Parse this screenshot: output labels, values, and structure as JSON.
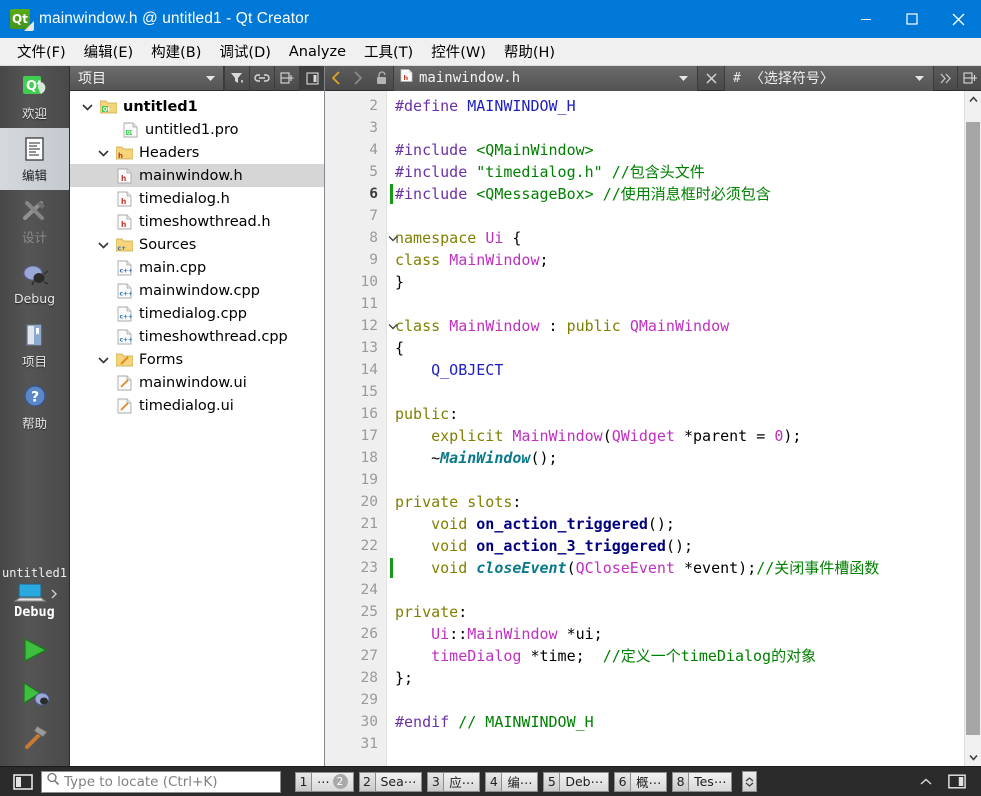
{
  "window": {
    "title": "mainwindow.h @ untitled1 - Qt Creator",
    "app_icon": "qt-logo-icon",
    "minimize": "minimize-icon",
    "maximize": "maximize-icon",
    "close": "close-icon",
    "titlebar_color": "#0078d7"
  },
  "menubar": {
    "items": [
      {
        "label": "文件(F)",
        "mnemonic": "F"
      },
      {
        "label": "编辑(E)",
        "mnemonic": "E"
      },
      {
        "label": "构建(B)",
        "mnemonic": "B"
      },
      {
        "label": "调试(D)",
        "mnemonic": "D"
      },
      {
        "label": "Analyze",
        "mnemonic": "A"
      },
      {
        "label": "工具(T)",
        "mnemonic": "T"
      },
      {
        "label": "控件(W)",
        "mnemonic": "W"
      },
      {
        "label": "帮助(H)",
        "mnemonic": "H"
      }
    ]
  },
  "modebar": {
    "modes": [
      {
        "label": "欢迎",
        "icon": "qt-welcome-icon",
        "state": "normal"
      },
      {
        "label": "编辑",
        "icon": "edit-document-icon",
        "state": "active"
      },
      {
        "label": "设计",
        "icon": "design-tools-icon",
        "state": "disabled"
      },
      {
        "label": "Debug",
        "icon": "debug-bug-icon",
        "state": "normal"
      },
      {
        "label": "项目",
        "icon": "projects-book-icon",
        "state": "normal"
      },
      {
        "label": "帮助",
        "icon": "help-question-icon",
        "state": "normal"
      }
    ],
    "kit": {
      "project_name": "untitled1",
      "build_config": "Debug",
      "target_icon": "desktop-target-icon",
      "run_button": "run-play-icon",
      "debug_button": "start-debugging-icon",
      "build_button": "build-hammer-icon"
    }
  },
  "project_panel": {
    "selector_label": "项目",
    "toolbar": [
      {
        "icon": "filter-icon",
        "name": "filter-tree-button"
      },
      {
        "icon": "link-icon",
        "name": "synchronize-with-editor-button"
      },
      {
        "icon": "collapse-all-icon",
        "name": "collapse-all-button"
      },
      {
        "icon": "split-icon",
        "name": "panel-layout-button"
      }
    ],
    "tree": [
      {
        "label": "untitled1",
        "icon": "qt-project-icon",
        "depth": 0,
        "expandable": true,
        "expanded": true,
        "bold": true,
        "selected": false
      },
      {
        "label": "untitled1.pro",
        "icon": "pro-file-icon",
        "depth": 1,
        "expandable": false,
        "expanded": false,
        "bold": false,
        "selected": false
      },
      {
        "label": "Headers",
        "icon": "folder-h-icon",
        "depth": 1,
        "expandable": true,
        "expanded": true,
        "bold": false,
        "selected": false
      },
      {
        "label": "mainwindow.h",
        "icon": "header-file-icon",
        "depth": 2,
        "expandable": false,
        "expanded": false,
        "bold": false,
        "selected": true
      },
      {
        "label": "timedialog.h",
        "icon": "header-file-icon",
        "depth": 2,
        "expandable": false,
        "expanded": false,
        "bold": false,
        "selected": false
      },
      {
        "label": "timeshowthread.h",
        "icon": "header-file-icon",
        "depth": 2,
        "expandable": false,
        "expanded": false,
        "bold": false,
        "selected": false
      },
      {
        "label": "Sources",
        "icon": "folder-cpp-icon",
        "depth": 1,
        "expandable": true,
        "expanded": true,
        "bold": false,
        "selected": false
      },
      {
        "label": "main.cpp",
        "icon": "cpp-file-icon",
        "depth": 2,
        "expandable": false,
        "expanded": false,
        "bold": false,
        "selected": false
      },
      {
        "label": "mainwindow.cpp",
        "icon": "cpp-file-icon",
        "depth": 2,
        "expandable": false,
        "expanded": false,
        "bold": false,
        "selected": false
      },
      {
        "label": "timedialog.cpp",
        "icon": "cpp-file-icon",
        "depth": 2,
        "expandable": false,
        "expanded": false,
        "bold": false,
        "selected": false
      },
      {
        "label": "timeshowthread.cpp",
        "icon": "cpp-file-icon",
        "depth": 2,
        "expandable": false,
        "expanded": false,
        "bold": false,
        "selected": false
      },
      {
        "label": "Forms",
        "icon": "folder-ui-icon",
        "depth": 1,
        "expandable": true,
        "expanded": true,
        "bold": false,
        "selected": false
      },
      {
        "label": "mainwindow.ui",
        "icon": "ui-file-icon",
        "depth": 2,
        "expandable": false,
        "expanded": false,
        "bold": false,
        "selected": false
      },
      {
        "label": "timedialog.ui",
        "icon": "ui-file-icon",
        "depth": 2,
        "expandable": false,
        "expanded": false,
        "bold": false,
        "selected": false
      }
    ]
  },
  "editor_toolbar": {
    "back": "back-arrow-icon",
    "forward": "forward-arrow-icon",
    "lock": "unlocked-padlock-icon",
    "file_icon": "header-file-icon",
    "file_name": "mainwindow.h",
    "close_tab": "close-x-icon",
    "symbol_prefix": "#",
    "symbol_label": "〈选择符号〉",
    "overflow": "chevrons-right-icon",
    "split": "split-editor-icon"
  },
  "editor": {
    "first_line": 2,
    "current_line": 6,
    "change_marker_lines": [
      6,
      23
    ],
    "fold_marker_lines": [
      8,
      12
    ],
    "lines": [
      {
        "n": 2,
        "tokens": [
          {
            "t": "#define ",
            "c": "pre"
          },
          {
            "t": "MAINWINDOW_H",
            "c": "macro"
          }
        ]
      },
      {
        "n": 3,
        "tokens": []
      },
      {
        "n": 4,
        "tokens": [
          {
            "t": "#include ",
            "c": "pre"
          },
          {
            "t": "<QMainWindow>",
            "c": "str"
          }
        ]
      },
      {
        "n": 5,
        "tokens": [
          {
            "t": "#include ",
            "c": "pre"
          },
          {
            "t": "\"timedialog.h\"",
            "c": "str"
          },
          {
            "t": " ",
            "c": "plain"
          },
          {
            "t": "//包含头文件",
            "c": "cmt"
          }
        ]
      },
      {
        "n": 6,
        "tokens": [
          {
            "t": "#include ",
            "c": "pre"
          },
          {
            "t": "<QMessageBox>",
            "c": "str"
          },
          {
            "t": " ",
            "c": "plain"
          },
          {
            "t": "//使用消息框时必须包含",
            "c": "cmt"
          }
        ]
      },
      {
        "n": 7,
        "tokens": []
      },
      {
        "n": 8,
        "tokens": [
          {
            "t": "namespace",
            "c": "kw"
          },
          {
            "t": " ",
            "c": "plain"
          },
          {
            "t": "Ui",
            "c": "type"
          },
          {
            "t": " {",
            "c": "plain"
          }
        ]
      },
      {
        "n": 9,
        "tokens": [
          {
            "t": "class",
            "c": "kw"
          },
          {
            "t": " ",
            "c": "plain"
          },
          {
            "t": "MainWindow",
            "c": "type"
          },
          {
            "t": ";",
            "c": "plain"
          }
        ]
      },
      {
        "n": 10,
        "tokens": [
          {
            "t": "}",
            "c": "plain"
          }
        ]
      },
      {
        "n": 11,
        "tokens": []
      },
      {
        "n": 12,
        "tokens": [
          {
            "t": "class",
            "c": "kw"
          },
          {
            "t": " ",
            "c": "plain"
          },
          {
            "t": "MainWindow",
            "c": "type"
          },
          {
            "t": " : ",
            "c": "plain"
          },
          {
            "t": "public",
            "c": "kw"
          },
          {
            "t": " ",
            "c": "plain"
          },
          {
            "t": "QMainWindow",
            "c": "type"
          }
        ]
      },
      {
        "n": 13,
        "tokens": [
          {
            "t": "{",
            "c": "plain"
          }
        ]
      },
      {
        "n": 14,
        "tokens": [
          {
            "t": "    ",
            "c": "plain"
          },
          {
            "t": "Q_OBJECT",
            "c": "macro"
          }
        ]
      },
      {
        "n": 15,
        "tokens": []
      },
      {
        "n": 16,
        "tokens": [
          {
            "t": "public",
            "c": "kw"
          },
          {
            "t": ":",
            "c": "plain"
          }
        ]
      },
      {
        "n": 17,
        "tokens": [
          {
            "t": "    ",
            "c": "plain"
          },
          {
            "t": "explicit",
            "c": "kw"
          },
          {
            "t": " ",
            "c": "plain"
          },
          {
            "t": "MainWindow",
            "c": "type"
          },
          {
            "t": "(",
            "c": "plain"
          },
          {
            "t": "QWidget",
            "c": "type"
          },
          {
            "t": " *parent = ",
            "c": "plain"
          },
          {
            "t": "0",
            "c": "type"
          },
          {
            "t": ");",
            "c": "plain"
          }
        ]
      },
      {
        "n": 18,
        "tokens": [
          {
            "t": "    ",
            "c": "plain"
          },
          {
            "t": "~",
            "c": "plain"
          },
          {
            "t": "MainWindow",
            "c": "virt"
          },
          {
            "t": "();",
            "c": "plain"
          }
        ]
      },
      {
        "n": 19,
        "tokens": []
      },
      {
        "n": 20,
        "tokens": [
          {
            "t": "private",
            "c": "kw"
          },
          {
            "t": " ",
            "c": "plain"
          },
          {
            "t": "slots",
            "c": "kw"
          },
          {
            "t": ":",
            "c": "plain"
          }
        ]
      },
      {
        "n": 21,
        "tokens": [
          {
            "t": "    ",
            "c": "plain"
          },
          {
            "t": "void",
            "c": "kw"
          },
          {
            "t": " ",
            "c": "plain"
          },
          {
            "t": "on_action_triggered",
            "c": "fn"
          },
          {
            "t": "();",
            "c": "plain"
          }
        ]
      },
      {
        "n": 22,
        "tokens": [
          {
            "t": "    ",
            "c": "plain"
          },
          {
            "t": "void",
            "c": "kw"
          },
          {
            "t": " ",
            "c": "plain"
          },
          {
            "t": "on_action_3_triggered",
            "c": "fn"
          },
          {
            "t": "();",
            "c": "plain"
          }
        ]
      },
      {
        "n": 23,
        "tokens": [
          {
            "t": "    ",
            "c": "plain"
          },
          {
            "t": "void",
            "c": "kw"
          },
          {
            "t": " ",
            "c": "plain"
          },
          {
            "t": "closeEvent",
            "c": "virt"
          },
          {
            "t": "(",
            "c": "plain"
          },
          {
            "t": "QCloseEvent",
            "c": "type"
          },
          {
            "t": " *event);",
            "c": "plain"
          },
          {
            "t": "//关闭事件槽函数",
            "c": "cmt"
          }
        ]
      },
      {
        "n": 24,
        "tokens": []
      },
      {
        "n": 25,
        "tokens": [
          {
            "t": "private",
            "c": "kw"
          },
          {
            "t": ":",
            "c": "plain"
          }
        ]
      },
      {
        "n": 26,
        "tokens": [
          {
            "t": "    ",
            "c": "plain"
          },
          {
            "t": "Ui",
            "c": "type"
          },
          {
            "t": "::",
            "c": "plain"
          },
          {
            "t": "MainWindow",
            "c": "type"
          },
          {
            "t": " *ui;",
            "c": "plain"
          }
        ]
      },
      {
        "n": 27,
        "tokens": [
          {
            "t": "    ",
            "c": "plain"
          },
          {
            "t": "timeDialog",
            "c": "type"
          },
          {
            "t": " *time;  ",
            "c": "plain"
          },
          {
            "t": "//定义一个timeDialog的对象",
            "c": "cmt"
          }
        ]
      },
      {
        "n": 28,
        "tokens": [
          {
            "t": "};",
            "c": "plain"
          }
        ]
      },
      {
        "n": 29,
        "tokens": []
      },
      {
        "n": 30,
        "tokens": [
          {
            "t": "#endif ",
            "c": "pre"
          },
          {
            "t": "// MAINWINDOW_H",
            "c": "cmt"
          }
        ]
      },
      {
        "n": 31,
        "tokens": []
      }
    ]
  },
  "statusbar": {
    "sidebar_toggle": "toggle-sidebar-icon",
    "locator_placeholder": "Type to locate (Ctrl+K)",
    "locator_value": "",
    "locator_icon": "search-icon",
    "tabs": [
      {
        "num": "1",
        "label": "⋯",
        "badge": "2"
      },
      {
        "num": "2",
        "label": "Sea⋯",
        "badge": ""
      },
      {
        "num": "3",
        "label": "应⋯",
        "badge": ""
      },
      {
        "num": "4",
        "label": "编⋯",
        "badge": ""
      },
      {
        "num": "5",
        "label": "Deb⋯",
        "badge": ""
      },
      {
        "num": "6",
        "label": "概⋯",
        "badge": ""
      },
      {
        "num": "8",
        "label": "Tes⋯",
        "badge": ""
      }
    ],
    "stepper": "up-down-stepper",
    "expand": "expand-up-icon",
    "right_toggle": "toggle-right-sidebar-icon"
  },
  "colors": {
    "accent": "#0078d7",
    "chrome_dark": "#4a4a4a",
    "statusbar": "#2b2b2b",
    "selection": "#d6d6d6",
    "change_marker": "#179b17"
  }
}
